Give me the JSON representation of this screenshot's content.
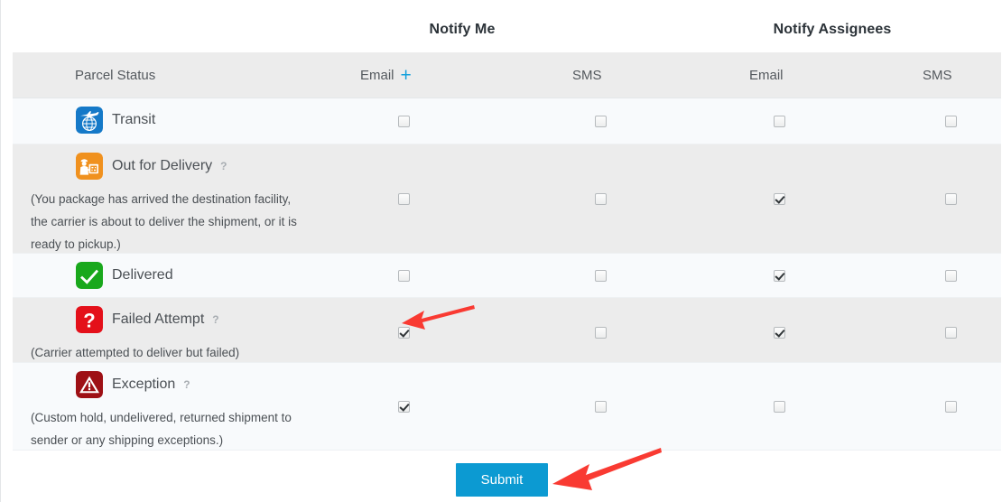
{
  "header": {
    "notify_me": "Notify Me",
    "notify_assignees": "Notify Assignees"
  },
  "columns": {
    "parcel_status": "Parcel Status",
    "me_email": "Email",
    "me_email_add_icon": "plus-icon",
    "me_sms": "SMS",
    "assignees_email": "Email",
    "assignees_sms": "SMS"
  },
  "rows": [
    {
      "id": "transit",
      "label": "Transit",
      "icon": "transit-globe-plane-icon",
      "icon_color": "#1579c8",
      "help": null,
      "description": null,
      "checks": {
        "me_email": false,
        "me_sms": false,
        "assignees_email": false,
        "assignees_sms": false
      }
    },
    {
      "id": "out-for-delivery",
      "label": "Out for Delivery",
      "icon": "out-for-delivery-courier-icon",
      "icon_color": "#f0911e",
      "help": "?",
      "description": "(You package has arrived the destination facility, the carrier is about to deliver the shipment, or it is ready to pickup.)",
      "checks": {
        "me_email": false,
        "me_sms": false,
        "assignees_email": true,
        "assignees_sms": false
      }
    },
    {
      "id": "delivered",
      "label": "Delivered",
      "icon": "delivered-check-icon",
      "icon_color": "#19a81c",
      "help": null,
      "description": null,
      "checks": {
        "me_email": false,
        "me_sms": false,
        "assignees_email": true,
        "assignees_sms": false
      }
    },
    {
      "id": "failed-attempt",
      "label": "Failed Attempt",
      "icon": "failed-attempt-question-icon",
      "icon_color": "#e4101a",
      "help": "?",
      "description": "(Carrier attempted to deliver but failed)",
      "checks": {
        "me_email": true,
        "me_sms": false,
        "assignees_email": true,
        "assignees_sms": false
      }
    },
    {
      "id": "exception",
      "label": "Exception",
      "icon": "exception-warning-icon",
      "icon_color": "#9e1015",
      "help": "?",
      "description": "(Custom hold, undelivered, returned shipment to sender or any shipping exceptions.)",
      "checks": {
        "me_email": true,
        "me_sms": false,
        "assignees_email": false,
        "assignees_sms": false
      }
    }
  ],
  "footer": {
    "submit_label": "Submit",
    "submit_color": "#0c9ad2"
  },
  "annotations": {
    "color": "#f93a32",
    "arrow_failed_attempt": "arrow-pointing-to-failed-attempt-me-email-checkbox",
    "arrow_submit": "arrow-pointing-to-submit-button"
  }
}
